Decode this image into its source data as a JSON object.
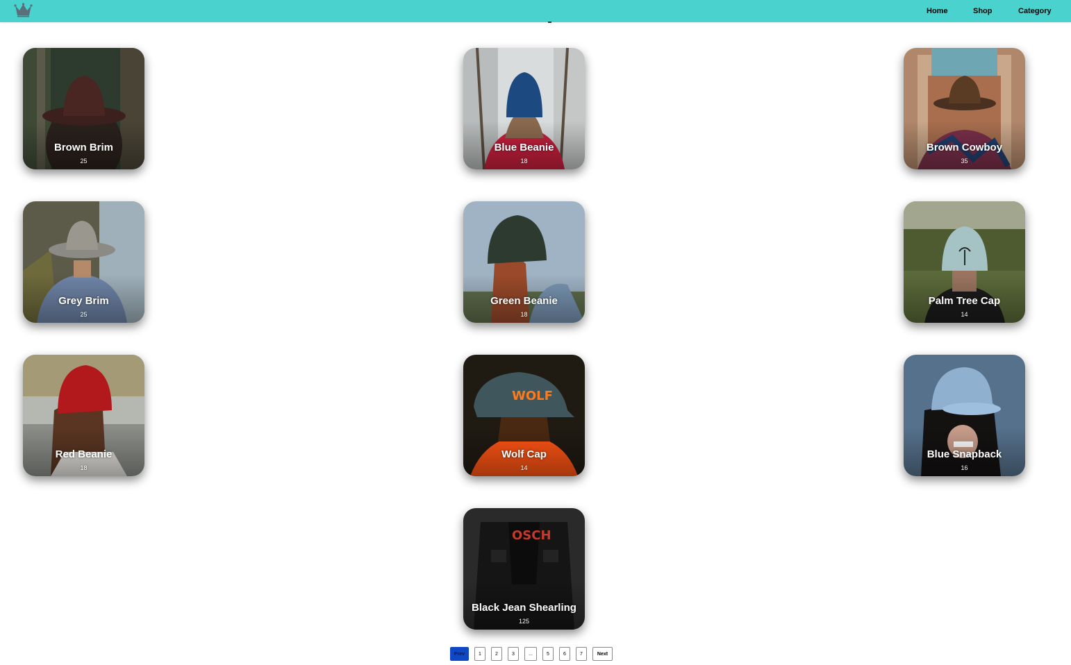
{
  "nav": {
    "logo_icon": "crown-icon",
    "links": [
      "Home",
      "Shop",
      "Category"
    ]
  },
  "products": [
    {
      "name": "Brown Brim",
      "count": "25"
    },
    {
      "name": "Blue Beanie",
      "count": "18"
    },
    {
      "name": "Brown Cowboy",
      "count": "35"
    },
    {
      "name": "Grey Brim",
      "count": "25"
    },
    {
      "name": "Green Beanie",
      "count": "18"
    },
    {
      "name": "Palm Tree Cap",
      "count": "14"
    },
    {
      "name": "Red Beanie",
      "count": "18"
    },
    {
      "name": "Wolf Cap",
      "count": "14"
    },
    {
      "name": "Blue Snapback",
      "count": "16"
    },
    {
      "name": "Black Jean Shearling",
      "count": "125"
    }
  ],
  "pagination": {
    "prev": "Prev",
    "pages": [
      "1",
      "2",
      "3",
      "...",
      "5",
      "6",
      "7"
    ],
    "next": "Next",
    "active": "Prev"
  },
  "colors": {
    "navbar": "#4ad2cf",
    "active_page": "#0f47c4"
  }
}
